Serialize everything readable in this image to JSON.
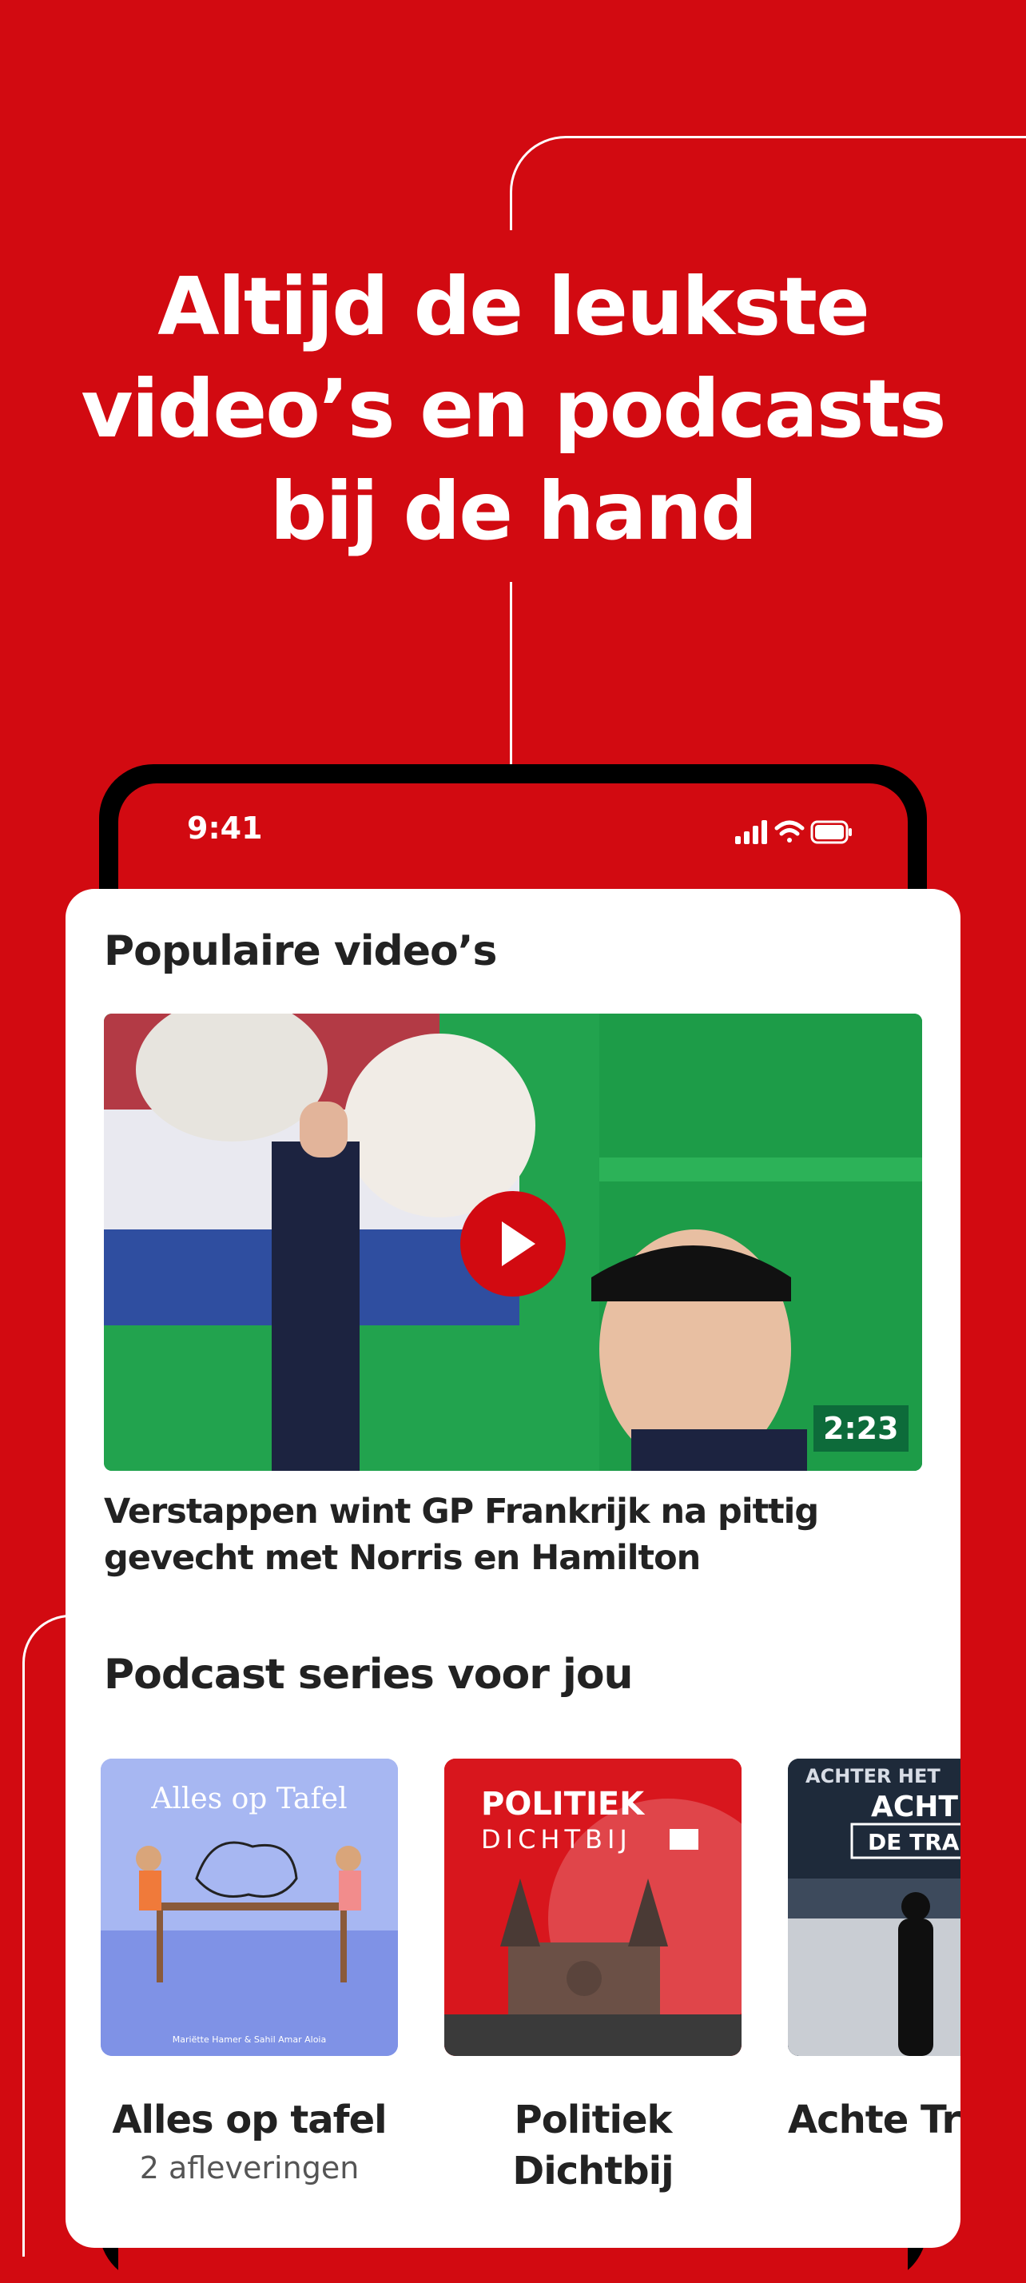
{
  "promo": {
    "headline": "Altijd de leukste video’s en podcasts bij de hand"
  },
  "status_bar": {
    "time": "9:41",
    "icons": [
      "signal-icon",
      "wifi-icon",
      "battery-icon"
    ]
  },
  "popular_videos": {
    "title": "Populaire video’s",
    "featured": {
      "duration": "2:23",
      "title": "Verstappen wint GP Frankrijk na pittig gevecht met Norris en Hamilton"
    }
  },
  "podcasts": {
    "title": "Podcast series voor jou",
    "items": [
      {
        "cover_title": "Alles op Tafel",
        "cover_credit": "Mariëtte Hamer & Sahil Amar Aloia",
        "name": "Alles op tafel",
        "episodes": "2 afleveringen"
      },
      {
        "cover_title_1": "POLITIEK",
        "cover_title_2": "DICHTBIJ",
        "name": "Politiek Dichtbij"
      },
      {
        "cover_title_1": "ACHTER HET",
        "cover_title_2": "ACHT",
        "cover_title_3": "DE TRA",
        "name": "Achte Trali"
      }
    ]
  },
  "colors": {
    "brand_red": "#d20a11",
    "badge_green": "#0d6b3a"
  }
}
